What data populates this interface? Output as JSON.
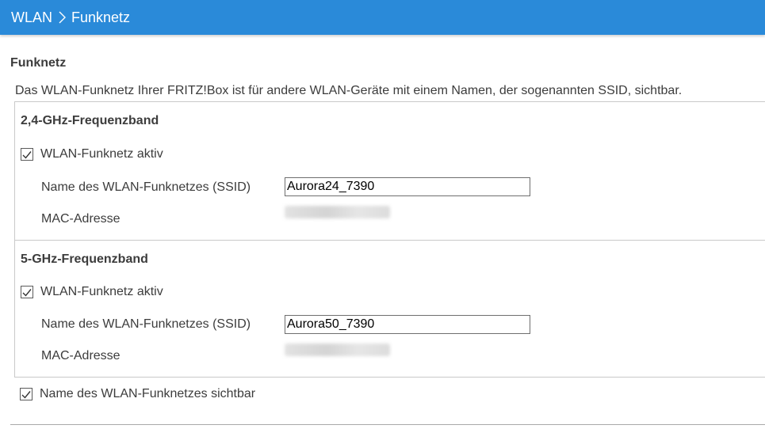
{
  "header": {
    "crumb_parent": "WLAN",
    "crumb_current": "Funknetz"
  },
  "page": {
    "section_title": "Funknetz",
    "intro": "Das WLAN-Funknetz Ihrer FRITZ!Box ist für andere WLAN-Geräte mit einem Namen, der sogenannten SSID, sichtbar."
  },
  "band24": {
    "title": "2,4-GHz-Frequenzband",
    "active_label": "WLAN-Funknetz aktiv",
    "active_checked": true,
    "ssid_label": "Name des WLAN-Funknetzes (SSID)",
    "ssid_value": "Aurora24_7390",
    "mac_label": "MAC-Adresse"
  },
  "band5": {
    "title": "5-GHz-Frequenzband",
    "active_label": "WLAN-Funknetz aktiv",
    "active_checked": true,
    "ssid_label": "Name des WLAN-Funknetzes (SSID)",
    "ssid_value": "Aurora50_7390",
    "mac_label": "MAC-Adresse"
  },
  "visibility": {
    "label": "Name des WLAN-Funknetzes sichtbar",
    "checked": true
  },
  "colors": {
    "header_bg": "#2a8ad9",
    "text": "#3c3c3c"
  }
}
